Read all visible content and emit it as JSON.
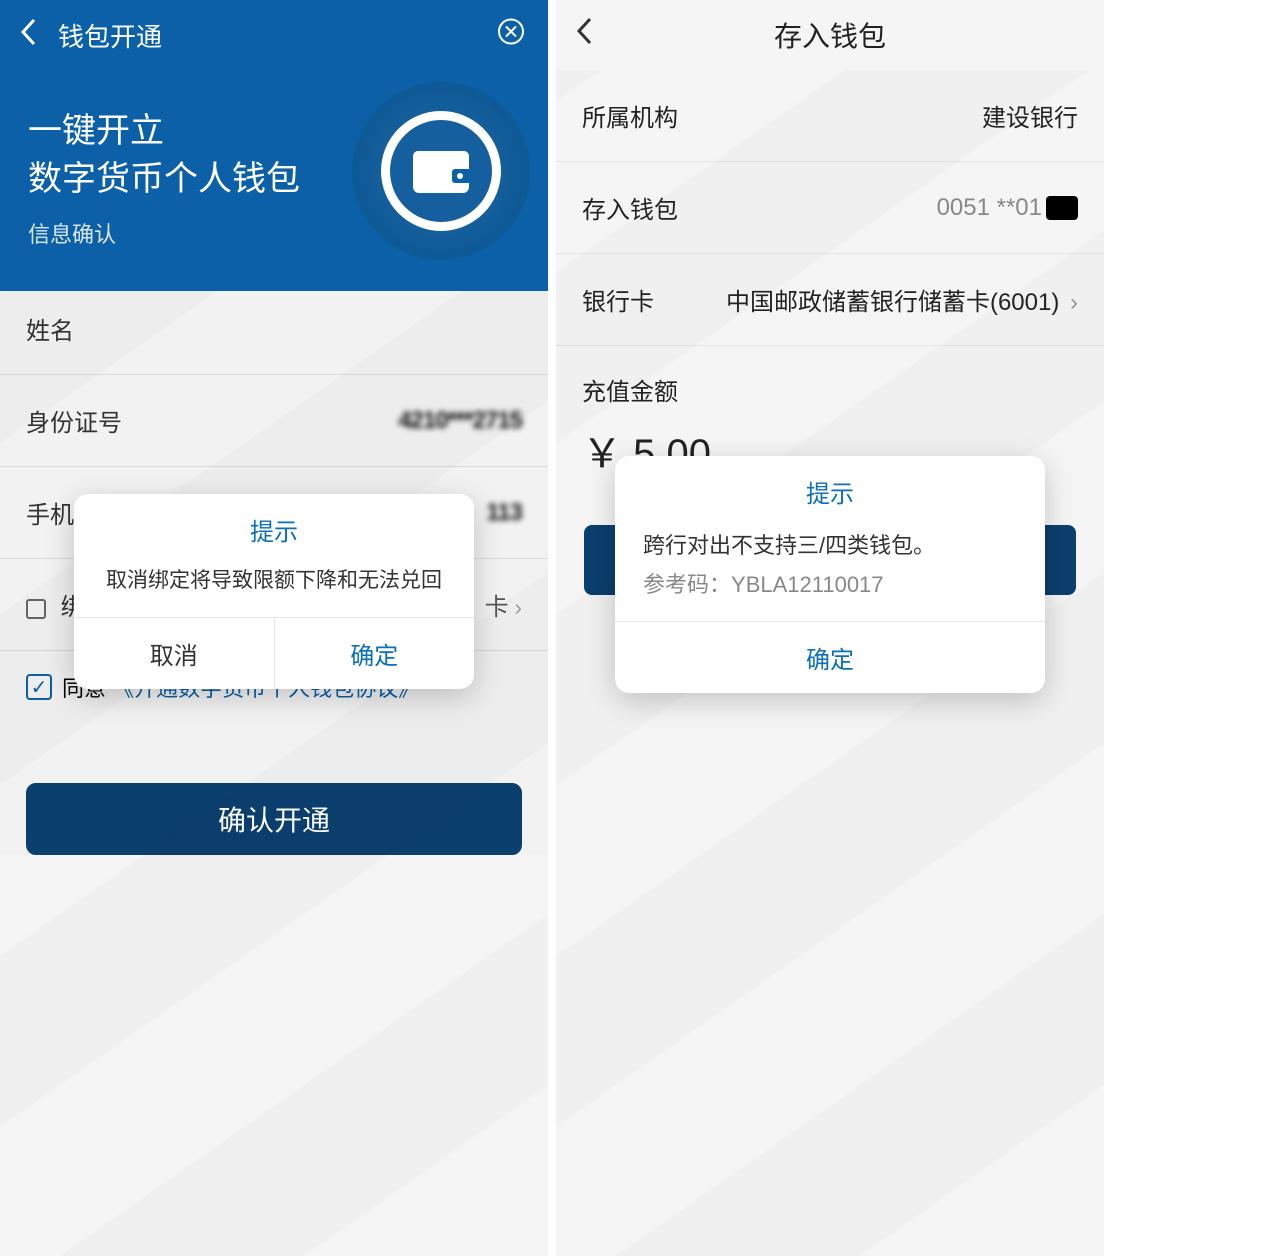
{
  "left": {
    "header_title": "钱包开通",
    "hero_line1": "一键开立",
    "hero_line2": "数字货币个人钱包",
    "hero_subtitle": "信息确认",
    "form": {
      "name_label": "姓名",
      "id_label": "身份证号",
      "id_value_masked": "4210***2715",
      "phone_label": "手机",
      "phone_trail": "113",
      "bind_label_prefix": "绑",
      "bind_trail": "卡"
    },
    "consent": {
      "agree": "同意",
      "link": "《开通数字货币个人钱包协议》"
    },
    "confirm_button": "确认开通",
    "modal": {
      "title": "提示",
      "body": "取消绑定将导致限额下降和无法兑回",
      "cancel": "取消",
      "ok": "确定"
    }
  },
  "right": {
    "header_title": "存入钱包",
    "rows": {
      "org_label": "所属机构",
      "org_value": "建设银行",
      "wallet_label": "存入钱包",
      "wallet_value_masked": "0051 **01",
      "card_label": "银行卡",
      "card_value": "中国邮政储蓄银行储蓄卡(6001)"
    },
    "amount_label": "充值金额",
    "amount_value": "￥ 5.00",
    "modal": {
      "title": "提示",
      "body": "跨行对出不支持三/四类钱包。",
      "ref_label": "参考码：",
      "ref_code": "YBLA12110017",
      "ok": "确定"
    }
  }
}
